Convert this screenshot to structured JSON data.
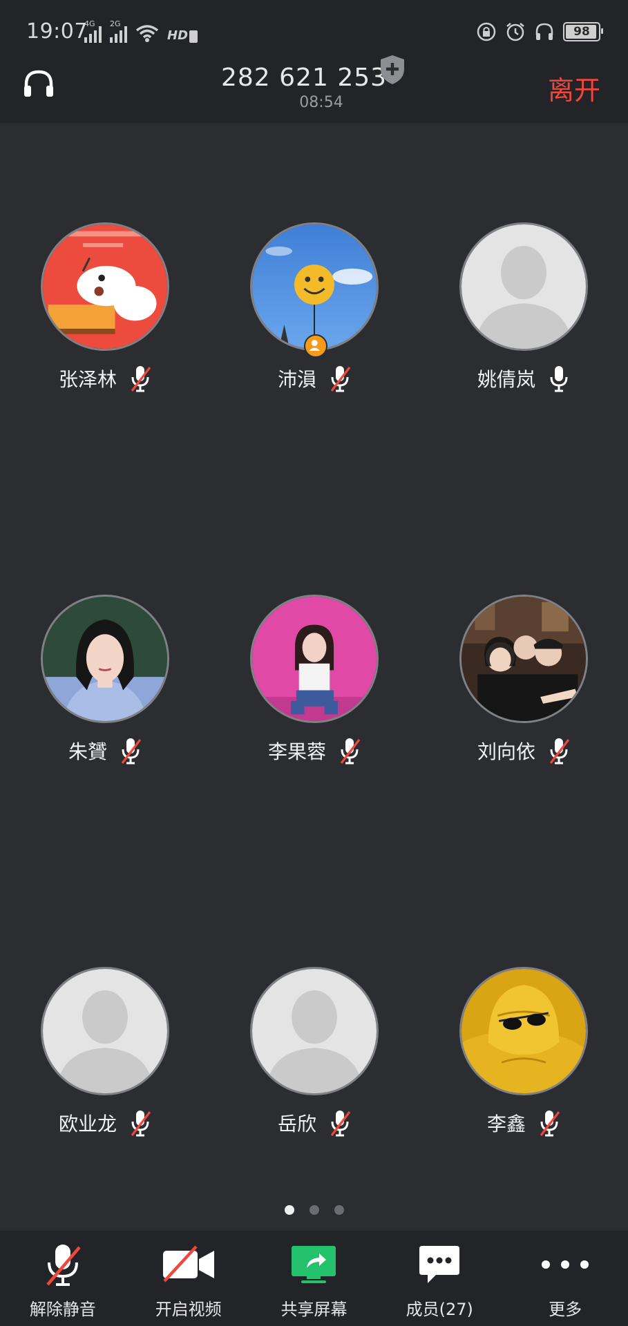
{
  "status_bar": {
    "time": "19:07",
    "network_4g": "4G",
    "network_2g": "2G",
    "hd_label": "HD",
    "battery": "98"
  },
  "header": {
    "meeting_id": "282 621 253",
    "duration": "08:54",
    "leave_label": "离开"
  },
  "participants": [
    {
      "name": "张泽林",
      "muted": true,
      "avatar": "cartoon-dog"
    },
    {
      "name": "沛溳",
      "muted": true,
      "avatar": "smiley-balloon-sky",
      "host": true
    },
    {
      "name": "姚倩岚",
      "muted": false,
      "avatar": "default"
    },
    {
      "name": "朱贇",
      "muted": true,
      "avatar": "portrait-woman"
    },
    {
      "name": "李果蓉",
      "muted": true,
      "avatar": "pink-wall-girl"
    },
    {
      "name": "刘向依",
      "muted": true,
      "avatar": "group-photo"
    },
    {
      "name": "欧业龙",
      "muted": true,
      "avatar": "default"
    },
    {
      "name": "岳欣",
      "muted": true,
      "avatar": "default"
    },
    {
      "name": "李鑫",
      "muted": true,
      "avatar": "yellow-hood"
    }
  ],
  "pagination": {
    "pages": 3,
    "current": 1
  },
  "toolbar": {
    "unmute_label": "解除静音",
    "video_label": "开启视频",
    "share_label": "共享屏幕",
    "members_label": "成员(27)",
    "more_label": "更多"
  },
  "colors": {
    "background": "#2b2d31",
    "bar": "#232428",
    "leave": "#f0473c",
    "share_green": "#25c26e",
    "host_badge": "#f59a1b"
  }
}
